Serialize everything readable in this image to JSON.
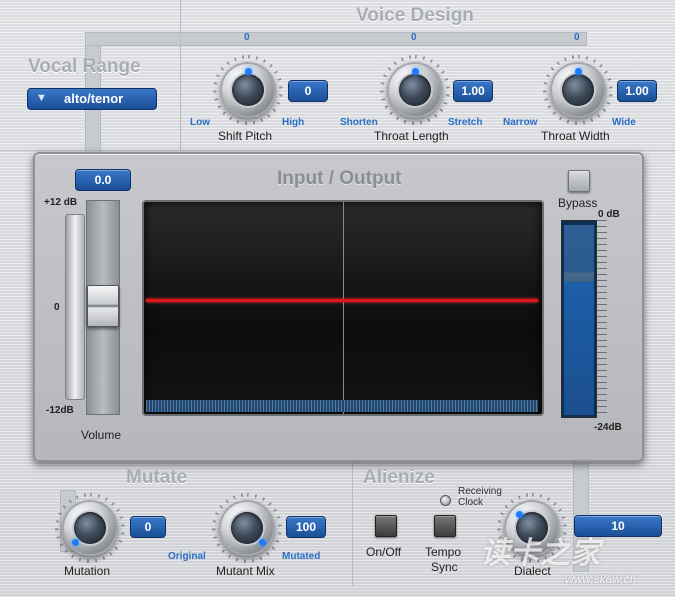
{
  "vocal_range": {
    "title": "Vocal Range",
    "selected": "alto/tenor",
    "arrow_icon": "triangle-down-icon"
  },
  "voice_design": {
    "title": "Voice Design",
    "shift_pitch": {
      "zero": "0",
      "value": "0",
      "label": "Shift Pitch",
      "min_label": "Low",
      "max_label": "High"
    },
    "throat_length": {
      "zero": "0",
      "value": "1.00",
      "label": "Throat Length",
      "min_label": "Shorten",
      "max_label": "Stretch"
    },
    "throat_width": {
      "zero": "0",
      "value": "1.00",
      "label": "Throat Width",
      "min_label": "Narrow",
      "max_label": "Wide"
    }
  },
  "io": {
    "title": "Input / Output",
    "volume_value": "0.0",
    "volume_label": "Volume",
    "scale_top": "+12 dB",
    "scale_mid": "0",
    "scale_bottom": "-12dB",
    "bypass_label": "Bypass",
    "meter_top": "0 dB",
    "meter_bottom": "-24dB"
  },
  "mutate": {
    "title": "Mutate",
    "mutation": {
      "value": "0",
      "label": "Mutation"
    },
    "mutant_mix": {
      "value": "100",
      "label": "Mutant Mix",
      "min_label": "Original",
      "max_label": "Mutated"
    }
  },
  "alienize": {
    "title": "Alienize",
    "receiving_clock_line1": "Receiving",
    "receiving_clock_line2": "Clock",
    "onoff_label": "On/Off",
    "tempo_sync_line1": "Tempo",
    "tempo_sync_line2": "Sync",
    "dialect_label": "Dialect",
    "dialect_value": "10"
  },
  "watermark": "www.skaw.cn",
  "colors": {
    "accent_blue": "#1e7dff",
    "value_box": "#1b4f97",
    "trace_red": "#e0141b",
    "meter_blue": "#1d5ea8"
  }
}
